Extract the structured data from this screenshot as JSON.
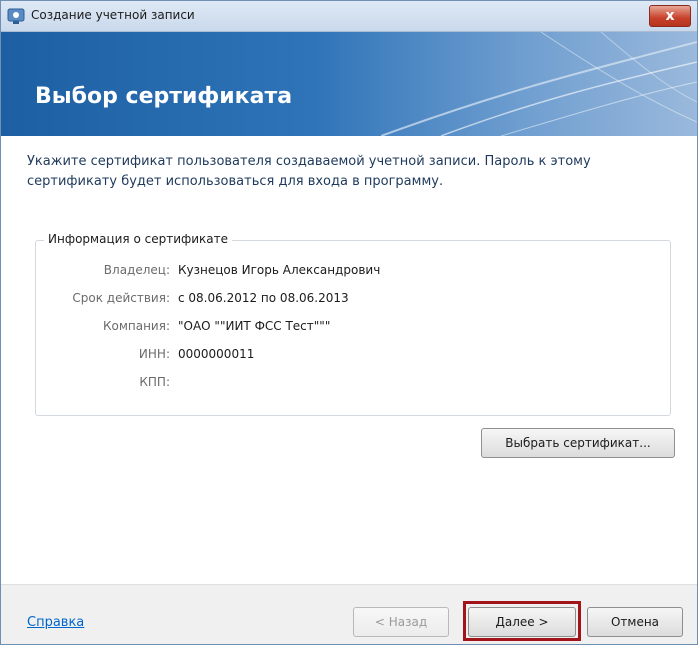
{
  "window": {
    "title": "Создание учетной записи",
    "close_label": "x"
  },
  "banner": {
    "title": "Выбор сертификата"
  },
  "instructions": "Укажите сертификат пользователя создаваемой учетной записи. Пароль к этому сертификату будет использоваться для входа в программу.",
  "certificate_info": {
    "legend": "Информация о сертификате",
    "rows": [
      {
        "label": "Владелец:",
        "value": "Кузнецов Игорь Александрович"
      },
      {
        "label": "Срок действия:",
        "value": "с 08.06.2012 по 08.06.2013"
      },
      {
        "label": "Компания:",
        "value": "\"ОАО \"\"ИИТ ФСС Тест\"\"\""
      },
      {
        "label": "ИНН:",
        "value": "0000000011"
      },
      {
        "label": "КПП:",
        "value": ""
      }
    ]
  },
  "buttons": {
    "choose_certificate": "Выбрать сертификат...",
    "back": "< Назад",
    "next": "Далее >",
    "cancel": "Отмена"
  },
  "footer": {
    "help_link": "Справка"
  },
  "colors": {
    "banner_start": "#1d5fa3",
    "banner_end": "#9ab9dc",
    "link": "#0066cc",
    "highlight_border": "#a1141a"
  },
  "icons": {
    "app": "app-icon",
    "close": "close-icon"
  }
}
